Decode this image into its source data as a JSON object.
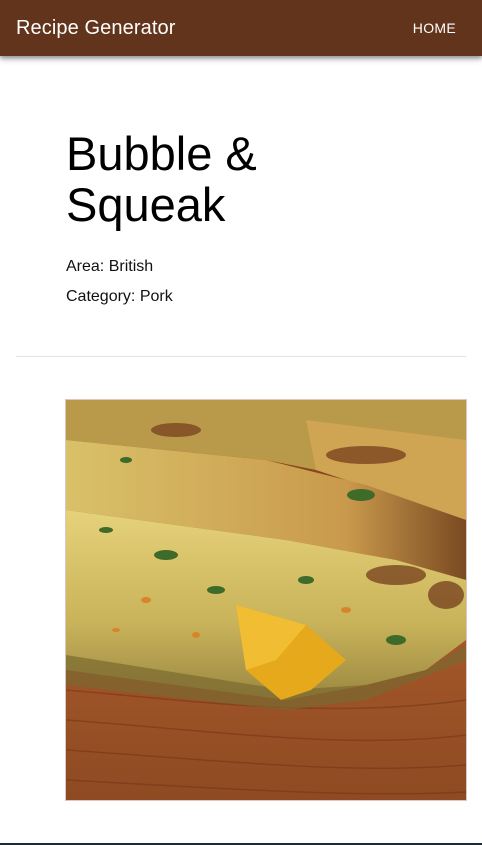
{
  "appbar": {
    "title": "Recipe Generator",
    "home_label": "HOME",
    "color": "#62341b"
  },
  "recipe": {
    "title": "Bubble & Squeak",
    "area_label": "Area: British",
    "category_label": "Category: Pork"
  }
}
